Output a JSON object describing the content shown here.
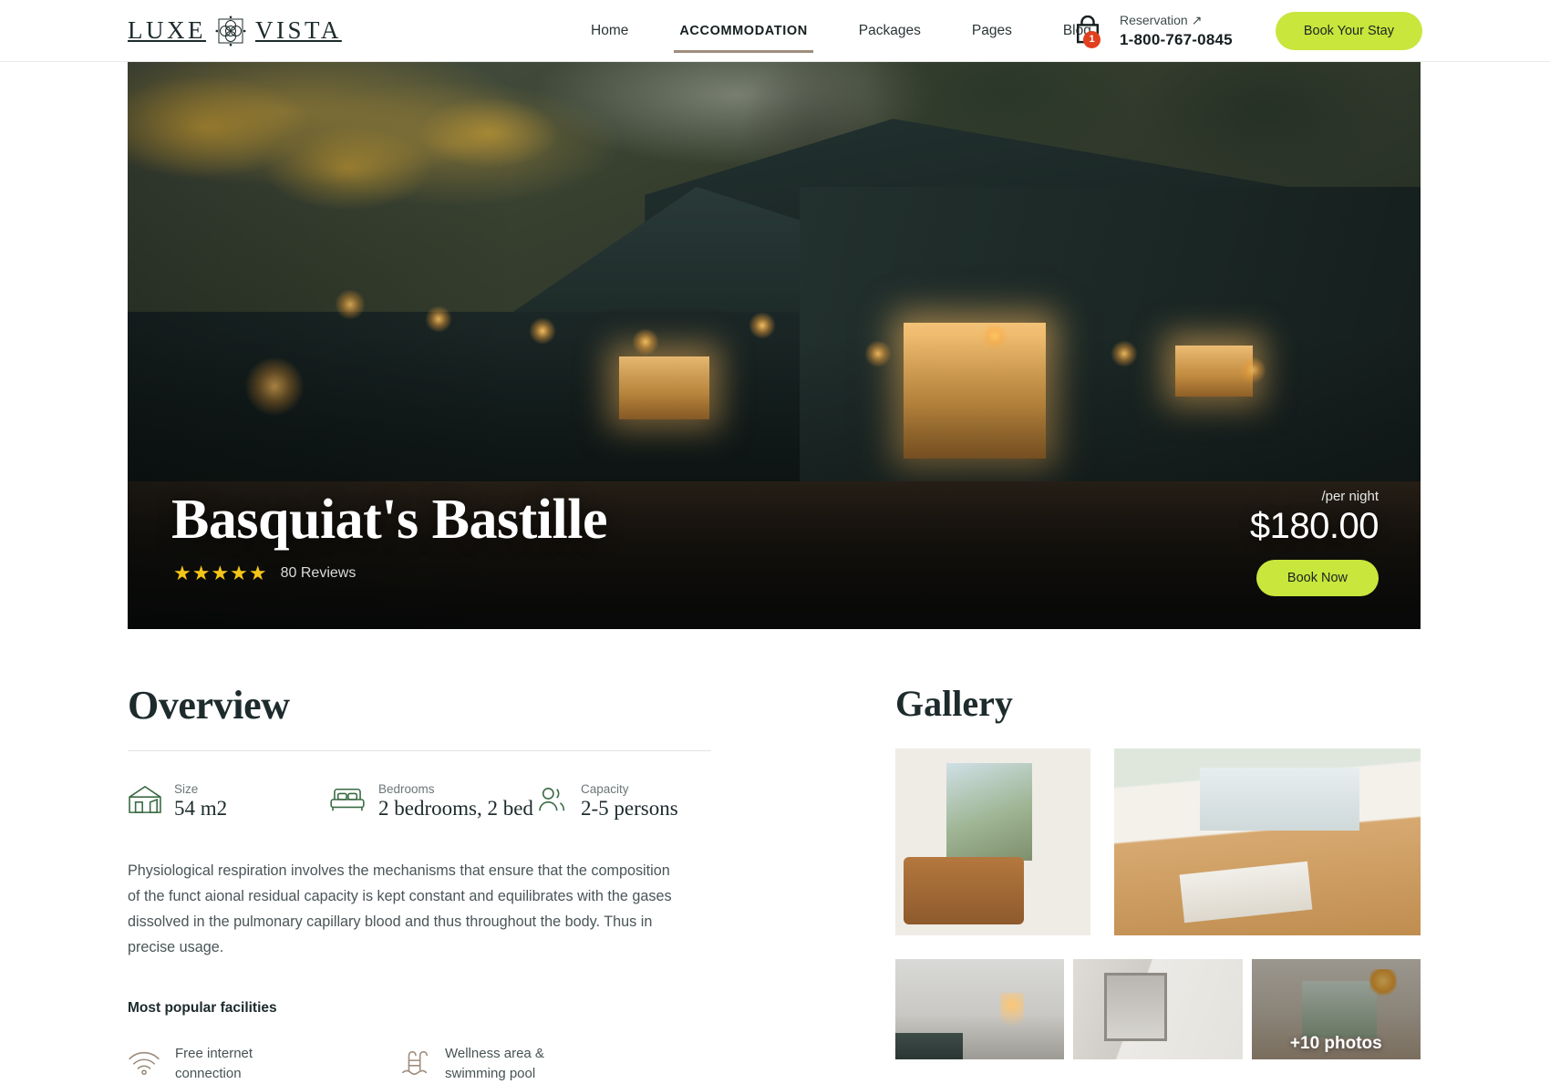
{
  "header": {
    "logo_left": "LUXE",
    "logo_right": "VISTA",
    "logo_mark_name": "ornamental-star-logo",
    "nav": [
      {
        "label": "Home",
        "active": false
      },
      {
        "label": "ACCOMMODATION",
        "active": true
      },
      {
        "label": "Packages",
        "active": false
      },
      {
        "label": "Pages",
        "active": false
      },
      {
        "label": "Blog",
        "active": false
      }
    ],
    "cart": {
      "icon": "shopping-bag-icon",
      "count": "1"
    },
    "reservation": {
      "label": "Reservation",
      "arrow": "↗",
      "phone": "1-800-767-0845"
    },
    "cta": "Book Your Stay",
    "accent_color": "#c8e63c",
    "underline_color": "#9e8d7d"
  },
  "hero": {
    "title": "Basquiat's Bastille",
    "stars": "★★★★★",
    "star_color": "#f5c518",
    "reviews": "80 Reviews",
    "per_night": "/per night",
    "price": "$180.00",
    "book_now": "Book Now"
  },
  "overview": {
    "title": "Overview",
    "specs": [
      {
        "icon": "house-size-icon",
        "label": "Size",
        "value": "54 m2"
      },
      {
        "icon": "bed-icon",
        "label": "Bedrooms",
        "value": "2 bedrooms, 2 bed"
      },
      {
        "icon": "people-capacity-icon",
        "label": "Capacity",
        "value": "2-5 persons"
      }
    ],
    "body": "Physiological respiration involves the mechanisms that ensure that the composition of the funct aional residual capacity is kept constant and equilibrates with the gases dissolved in the pulmonary capillary blood and thus throughout the body. Thus in precise usage.",
    "facilities_title": "Most popular facilities",
    "facilities": [
      {
        "icon": "wifi-icon",
        "line1": "Free internet",
        "line2": "connection"
      },
      {
        "icon": "pool-ladder-icon",
        "line1": "Wellness area &",
        "line2": "swimming pool"
      }
    ],
    "icon_color": "#3a6b43",
    "facility_icon_color": "#9e8d7d"
  },
  "gallery": {
    "title": "Gallery",
    "row1": [
      {
        "name": "gallery-image-living-room"
      },
      {
        "name": "gallery-image-dining-room"
      }
    ],
    "row2": [
      {
        "name": "gallery-image-bedroom"
      },
      {
        "name": "gallery-image-bathroom"
      },
      {
        "name": "gallery-image-bay-window"
      }
    ],
    "more_label": "+10 photos"
  }
}
